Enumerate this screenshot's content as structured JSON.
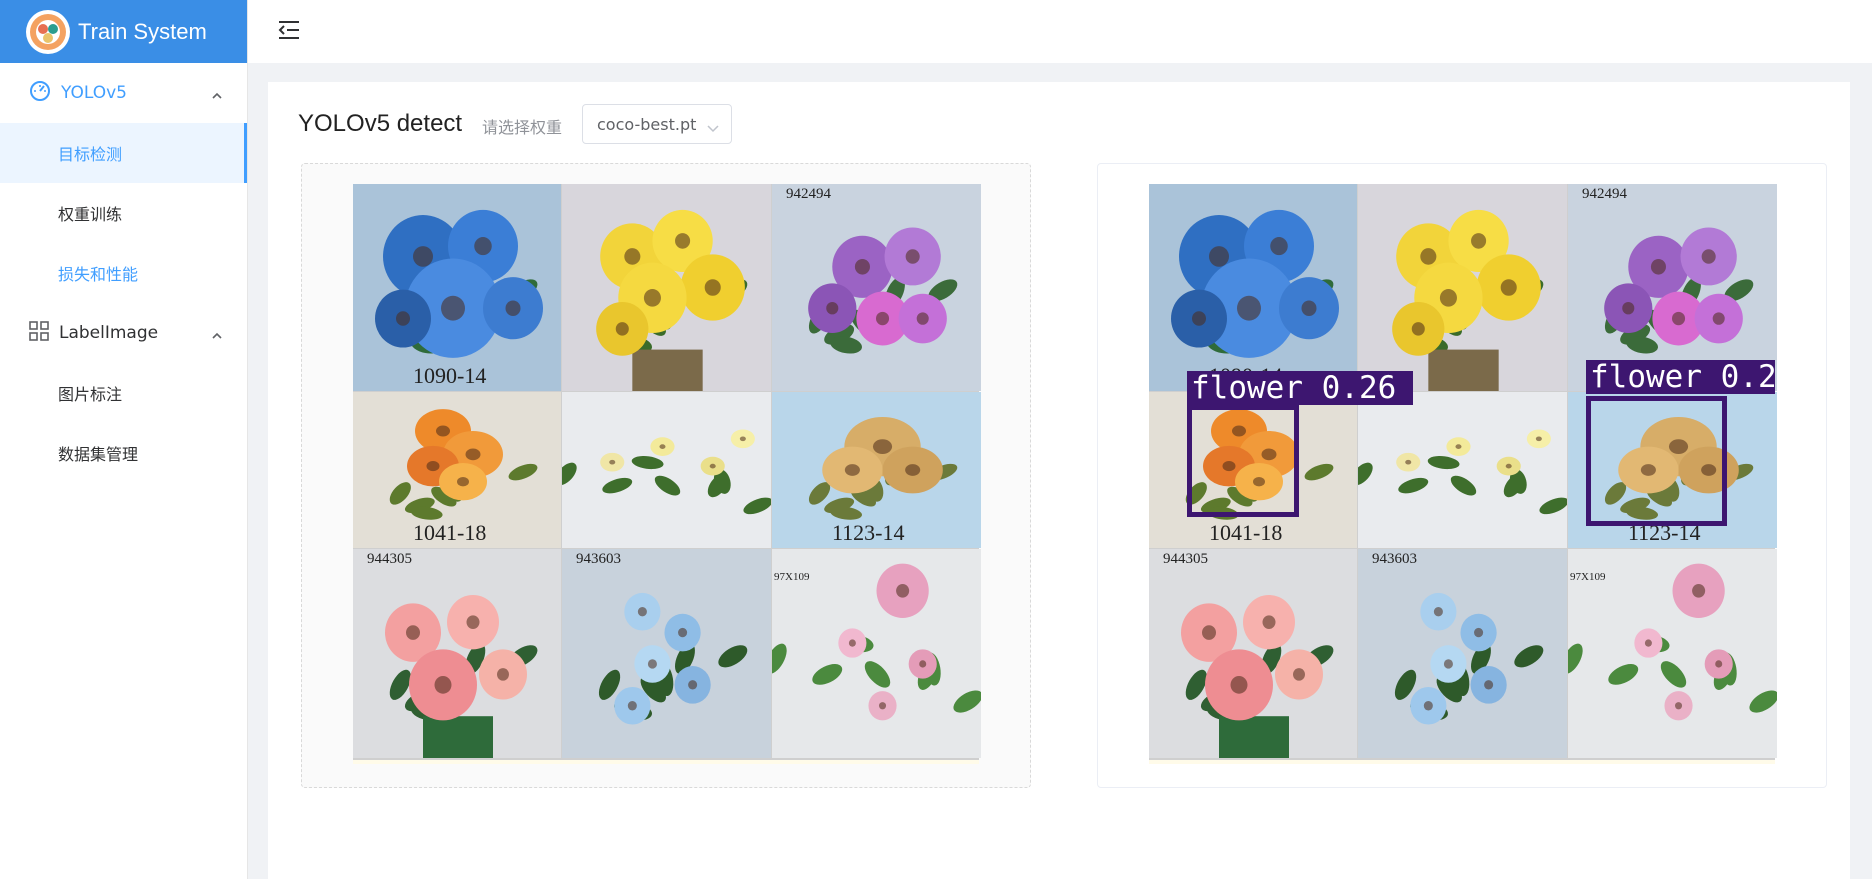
{
  "app": {
    "title": "Train System",
    "brand_color": "#3a8ee6",
    "accent": "#409eff"
  },
  "sidebar": {
    "groups": [
      {
        "icon": "dashboard-icon",
        "label": "YOLOv5",
        "items": [
          {
            "label": "目标检测",
            "state": "active"
          },
          {
            "label": "权重训练",
            "state": "normal"
          },
          {
            "label": "损失和性能",
            "state": "link"
          }
        ]
      },
      {
        "icon": "grid-icon",
        "label": "LabelImage",
        "items": [
          {
            "label": "图片标注",
            "state": "normal"
          },
          {
            "label": "数据集管理",
            "state": "normal"
          }
        ]
      }
    ]
  },
  "main": {
    "title": "YOLOv5 detect",
    "weight_hint": "请选择权重",
    "weight_value": "coco-best.pt",
    "source_tiles": [
      {
        "tag": "1090-14"
      },
      {
        "tag": ""
      },
      {
        "tag": "942494"
      },
      {
        "tag": "1041-18"
      },
      {
        "tag": ""
      },
      {
        "tag": "1123-14"
      },
      {
        "tag": "944305"
      },
      {
        "tag": "943603"
      },
      {
        "tag": "97X109"
      }
    ],
    "detections": [
      {
        "label": "flower 0.26"
      },
      {
        "label": "flower 0.2"
      }
    ],
    "detection_color": "#3d1670"
  }
}
